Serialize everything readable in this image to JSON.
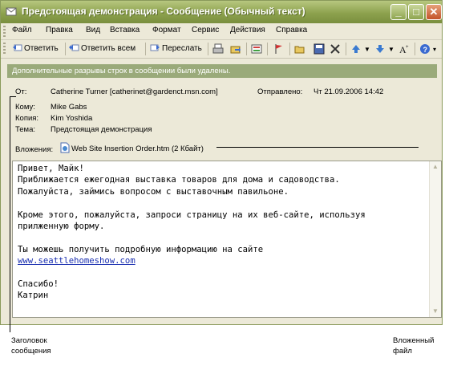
{
  "window": {
    "title": "Предстоящая демонстрация - Сообщение (Обычный текст)",
    "buttons": {
      "minimize": "_",
      "maximize": "□",
      "close": "✕"
    }
  },
  "menu": [
    "Файл",
    "Правка",
    "Вид",
    "Вставка",
    "Формат",
    "Сервис",
    "Действия",
    "Справка"
  ],
  "toolbar": {
    "reply": "Ответить",
    "reply_all": "Ответить всем",
    "forward": "Переслать"
  },
  "info_bar": "Дополнительные разрывы строк в сообщении были удалены.",
  "header": {
    "from_label": "От:",
    "from_value": "Catherine Turner [catherinet@gardenct.msn.com]",
    "sent_label": "Отправлено:",
    "sent_value": "Чт 21.09.2006 14:42",
    "to_label": "Кому:",
    "to_value": "Mike Gabs",
    "cc_label": "Копия:",
    "cc_value": "Kim Yoshida",
    "subject_label": "Тема:",
    "subject_value": "Предстоящая демонстрация",
    "attachments_label": "Вложения:",
    "attachment_name": "Web Site Insertion Order.htm (2 Кбайт)"
  },
  "body": {
    "line1": "Привет, Майк!",
    "line2": "Приближается ежегодная выставка товаров для дома и садоводства.",
    "line3": "Пожалуйста, займись вопросом с выставочным павильоне.",
    "line4": "",
    "line5": "Кроме этого, пожалуйста, запроси страницу на их веб-сайте, используя",
    "line6": "прилженную форму.",
    "line7": "",
    "line8": "Ты можешь получить подробную информацию на сайте",
    "link": "www.seattlehomeshow.com",
    "line10": "",
    "line11": "Спасибо!",
    "line12": "Катрин"
  },
  "callouts": {
    "header_caption_1": "Заголовок",
    "header_caption_2": "сообщения",
    "attachment_caption_1": "Вложенный",
    "attachment_caption_2": "файл"
  },
  "colors": {
    "titlebar": "#8da24e",
    "info_bar": "#9aaa7a",
    "link": "#1a2fb0"
  }
}
